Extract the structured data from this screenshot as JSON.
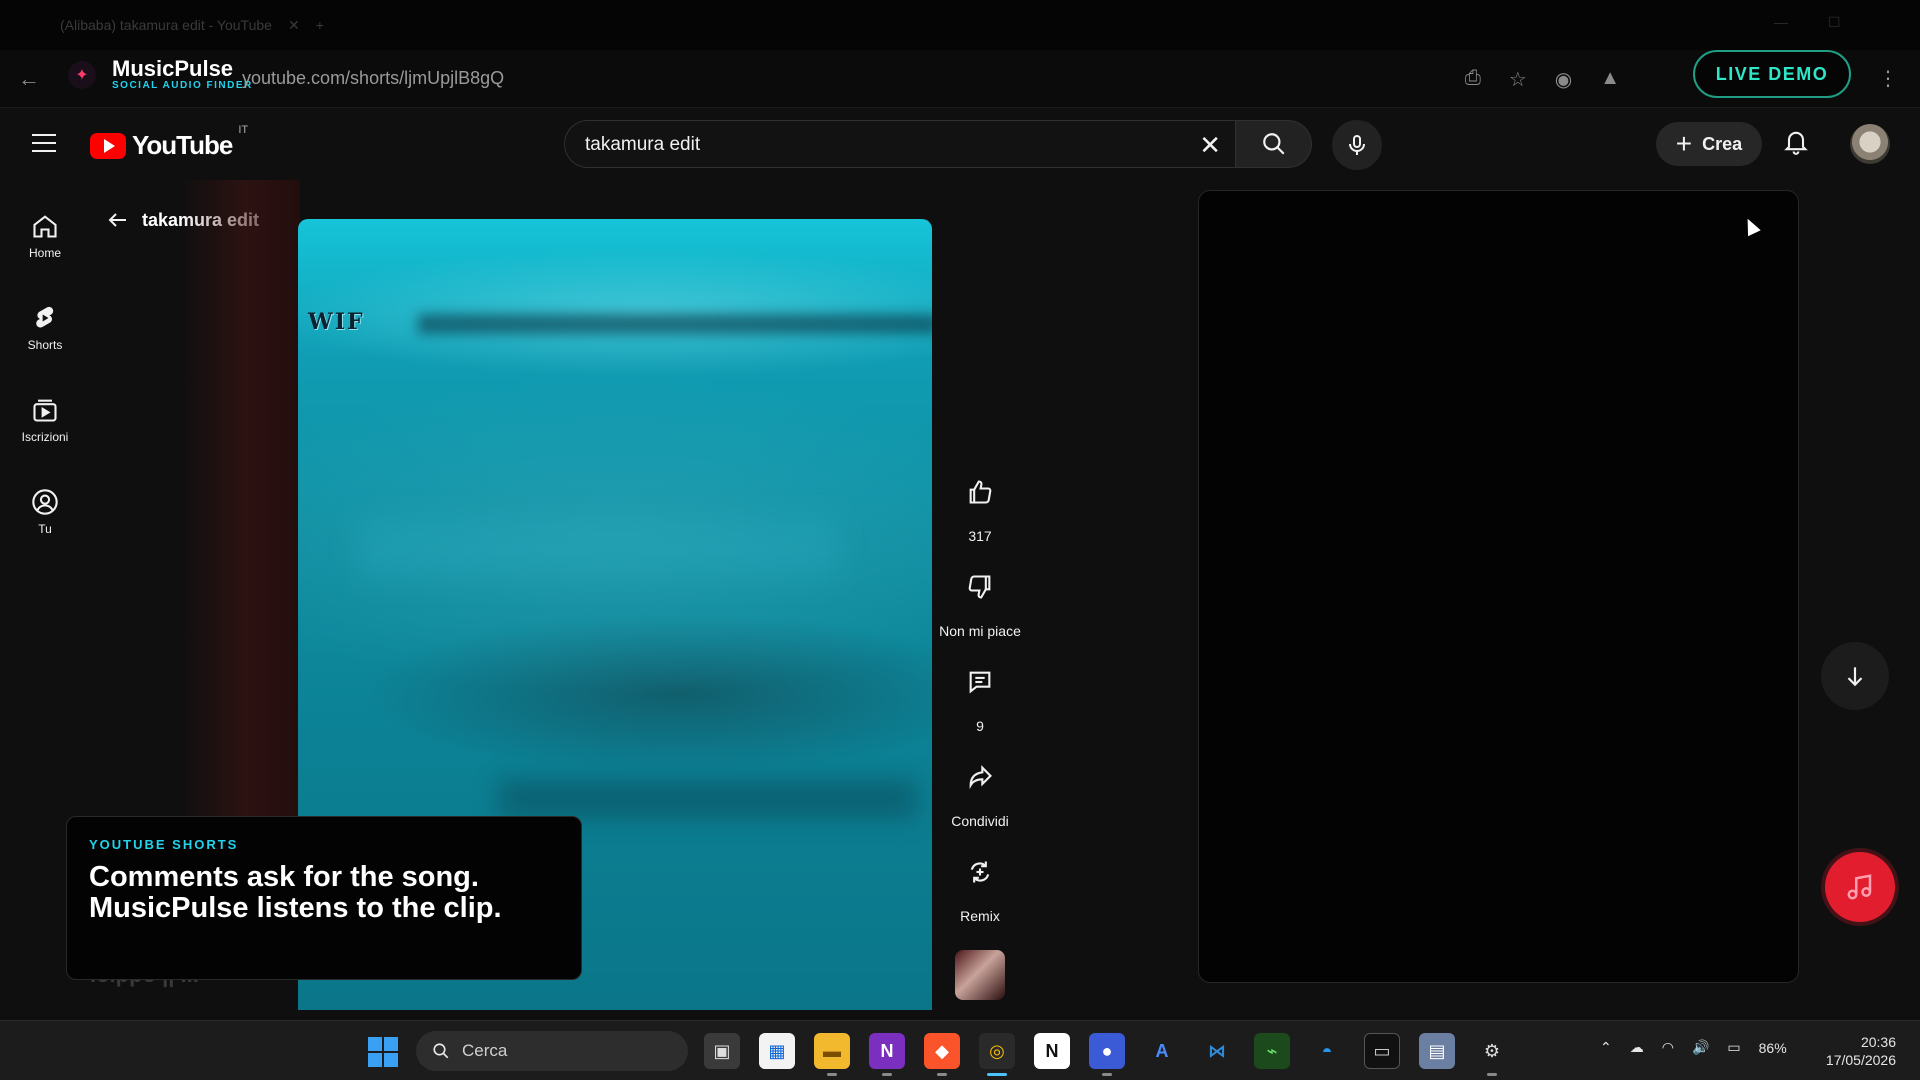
{
  "browser": {
    "tab_title": "(Alibaba) takamura edit - YouTube",
    "url": "youtube.com/shorts/ljmUpjlB8gQ",
    "live_demo": "LIVE DEMO"
  },
  "brand": {
    "name": "MusicPulse",
    "tagline": "SOCIAL AUDIO FINDER",
    "accent": "#22d3ee"
  },
  "youtube": {
    "logo_text": "YouTube",
    "country": "IT",
    "search_query": "takamura edit",
    "create_label": "Crea"
  },
  "sidebar": {
    "items": [
      {
        "label": "Home",
        "icon": "home-icon"
      },
      {
        "label": "Shorts",
        "icon": "shorts-icon"
      },
      {
        "label": "Iscrizioni",
        "icon": "subscriptions-icon"
      },
      {
        "label": "Tu",
        "icon": "you-icon"
      }
    ]
  },
  "page": {
    "back_title": "takamura edit"
  },
  "video": {
    "overlay_text": "WIF"
  },
  "actions": {
    "like_count": "317",
    "dislike_label": "Non mi piace",
    "comment_count": "9",
    "share_label": "Condividi",
    "remix_label": "Remix"
  },
  "promo": {
    "eyebrow": "YOUTUBE SHORTS",
    "headline": "Comments ask for the song. MusicPulse listens to the clip.",
    "ghost_text": "ıoıppo || ..."
  },
  "taskbar": {
    "search_label": "Cerca",
    "battery": "86%",
    "time": "20:36",
    "date": "17/05/2026"
  },
  "colors": {
    "youtube_red": "#ff0000",
    "fab_red": "#e11d2e",
    "live_demo_border": "#1f9e85",
    "video_teal": "#0f8fa2"
  }
}
